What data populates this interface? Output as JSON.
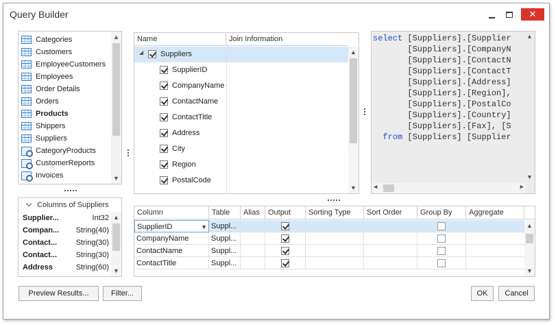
{
  "window": {
    "title": "Query Builder"
  },
  "tables_list": {
    "items": [
      {
        "label": "Categories",
        "icon": "table-icon",
        "bold": false
      },
      {
        "label": "Customers",
        "icon": "table-icon",
        "bold": false
      },
      {
        "label": "EmployeeCustomers",
        "icon": "table-icon",
        "bold": false
      },
      {
        "label": "Employees",
        "icon": "table-icon",
        "bold": false
      },
      {
        "label": "Order Details",
        "icon": "table-icon",
        "bold": false
      },
      {
        "label": "Orders",
        "icon": "table-icon",
        "bold": false
      },
      {
        "label": "Products",
        "icon": "table-icon",
        "bold": true
      },
      {
        "label": "Shippers",
        "icon": "table-icon",
        "bold": false
      },
      {
        "label": "Suppliers",
        "icon": "table-icon",
        "bold": false
      },
      {
        "label": "CategoryProducts",
        "icon": "view-icon",
        "bold": false
      },
      {
        "label": "CustomerReports",
        "icon": "view-icon",
        "bold": false
      },
      {
        "label": "Invoices",
        "icon": "view-icon",
        "bold": false
      }
    ]
  },
  "columns_panel": {
    "header": "Columns of Suppliers",
    "rows": [
      {
        "name": "Supplier...",
        "type": "Int32"
      },
      {
        "name": "Compan...",
        "type": "String(40)"
      },
      {
        "name": "Contact...",
        "type": "String(30)"
      },
      {
        "name": "Contact...",
        "type": "String(30)"
      },
      {
        "name": "Address",
        "type": "String(60)"
      }
    ]
  },
  "diagram": {
    "headers": {
      "name": "Name",
      "join": "Join Information"
    },
    "table_name": "Suppliers",
    "fields": [
      "SupplierID",
      "CompanyName",
      "ContactName",
      "ContactTitle",
      "Address",
      "City",
      "Region",
      "PostalCode"
    ]
  },
  "sql": {
    "lines": [
      {
        "kw": "select",
        "text": " [Suppliers].[Supplier"
      },
      {
        "kw": "",
        "text": "       [Suppliers].[CompanyN"
      },
      {
        "kw": "",
        "text": "       [Suppliers].[ContactN"
      },
      {
        "kw": "",
        "text": "       [Suppliers].[ContactT"
      },
      {
        "kw": "",
        "text": "       [Suppliers].[Address]"
      },
      {
        "kw": "",
        "text": "       [Suppliers].[Region],"
      },
      {
        "kw": "",
        "text": "       [Suppliers].[PostalCo"
      },
      {
        "kw": "",
        "text": "       [Suppliers].[Country]"
      },
      {
        "kw": "",
        "text": "       [Suppliers].[Fax], [S"
      },
      {
        "kw": "  from",
        "text": " [Suppliers] [Supplier"
      }
    ]
  },
  "query_grid": {
    "headers": {
      "column": "Column",
      "table": "Table",
      "alias": "Alias",
      "output": "Output",
      "sorting_type": "Sorting Type",
      "sort_order": "Sort Order",
      "group_by": "Group By",
      "aggregate": "Aggregate"
    },
    "rows": [
      {
        "column": "SupplierID",
        "table": "Suppl...",
        "output": true,
        "group_by": false
      },
      {
        "column": "CompanyName",
        "table": "Suppl...",
        "output": true,
        "group_by": false
      },
      {
        "column": "ContactName",
        "table": "Suppl...",
        "output": true,
        "group_by": false
      },
      {
        "column": "ContactTitle",
        "table": "Suppl...",
        "output": true,
        "group_by": false
      }
    ]
  },
  "buttons": {
    "preview": "Preview Results...",
    "filter": "Filter...",
    "ok": "OK",
    "cancel": "Cancel"
  },
  "colors": {
    "accent": "#3a7fc4",
    "selection": "#d5e8f9",
    "close": "#d9342a",
    "keyword": "#1a4bd1"
  }
}
